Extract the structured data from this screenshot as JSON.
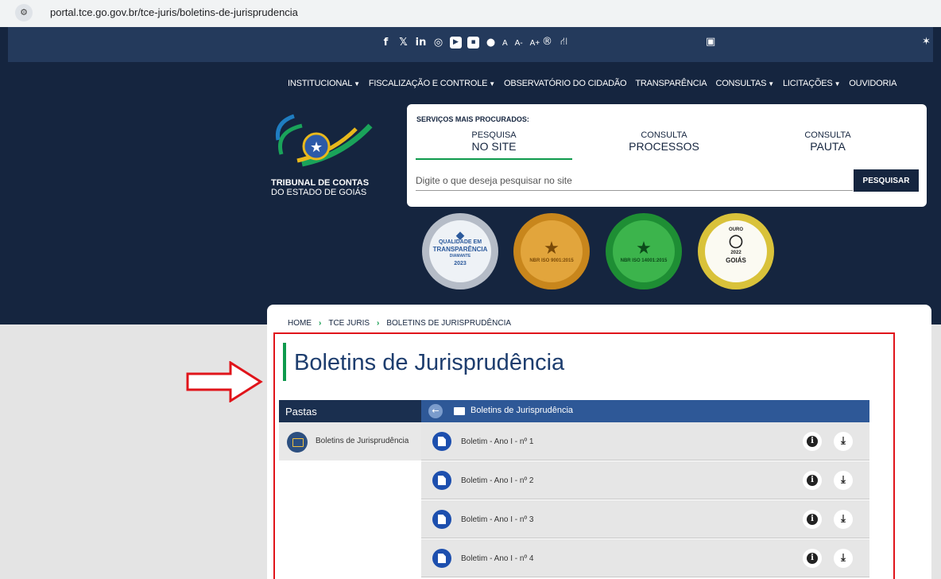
{
  "browser": {
    "url": "portal.tce.go.gov.br/tce-juris/boletins-de-jurisprudencia",
    "site_info_icon": "tune-icon"
  },
  "utility": {
    "social": [
      "f",
      "𝕏",
      "in",
      "◎",
      "▶",
      "▪",
      "●"
    ],
    "font_sizes": [
      "A",
      "A-",
      "A+"
    ],
    "accessibility": [
      "®",
      "⛙"
    ]
  },
  "nav": [
    {
      "label": "INSTITUCIONAL",
      "caret": "▼"
    },
    {
      "label": "FISCALIZAÇÃO E CONTROLE",
      "caret": "▼"
    },
    {
      "label": "OBSERVATÓRIO DO CIDADÃO",
      "caret": ""
    },
    {
      "label": "TRANSPARÊNCIA",
      "caret": ""
    },
    {
      "label": "CONSULTAS",
      "caret": "▼"
    },
    {
      "label": "LICITAÇÕES",
      "caret": "▼"
    },
    {
      "label": "OUVIDORIA",
      "caret": ""
    }
  ],
  "logo": {
    "line1": "TRIBUNAL DE CONTAS",
    "line2": "DO ESTADO DE GOIÁS"
  },
  "services": {
    "title": "SERVIÇOS MAIS PROCURADOS:",
    "tabs": [
      {
        "l1": "PESQUISA",
        "l2": "NO SITE"
      },
      {
        "l1": "CONSULTA",
        "l2": "PROCESSOS"
      },
      {
        "l1": "CONSULTA",
        "l2": "PAUTA"
      }
    ],
    "placeholder": "Digite o que deseja pesquisar no site",
    "button": "PESQUISAR"
  },
  "seals": {
    "s1": {
      "l1": "QUALIDADE EM",
      "l2": "TRANSPARÊNCIA",
      "l3": "DIAMANTE",
      "l4": "2023"
    },
    "s2": {
      "l1": "NBR ISO 9001:2015"
    },
    "s3": {
      "l1": "NBR ISO 14001:2015"
    },
    "s4": {
      "l1": "OURO",
      "l2": "2022",
      "l3": "GOIÁS"
    }
  },
  "breadcrumb": [
    "HOME",
    "TCE JURIS",
    "BOLETINS DE JURISPRUDÊNCIA"
  ],
  "page_title": "Boletins de Jurisprudência",
  "pastas": {
    "header": "Pastas",
    "item": "Boletins de Jurisprudência"
  },
  "files": {
    "header": "Boletins de Jurisprudência",
    "rows": [
      "Boletim - Ano I - nº 1",
      "Boletim - Ano I - nº 2",
      "Boletim - Ano I - nº 3",
      "Boletim - Ano I - nº 4"
    ]
  }
}
